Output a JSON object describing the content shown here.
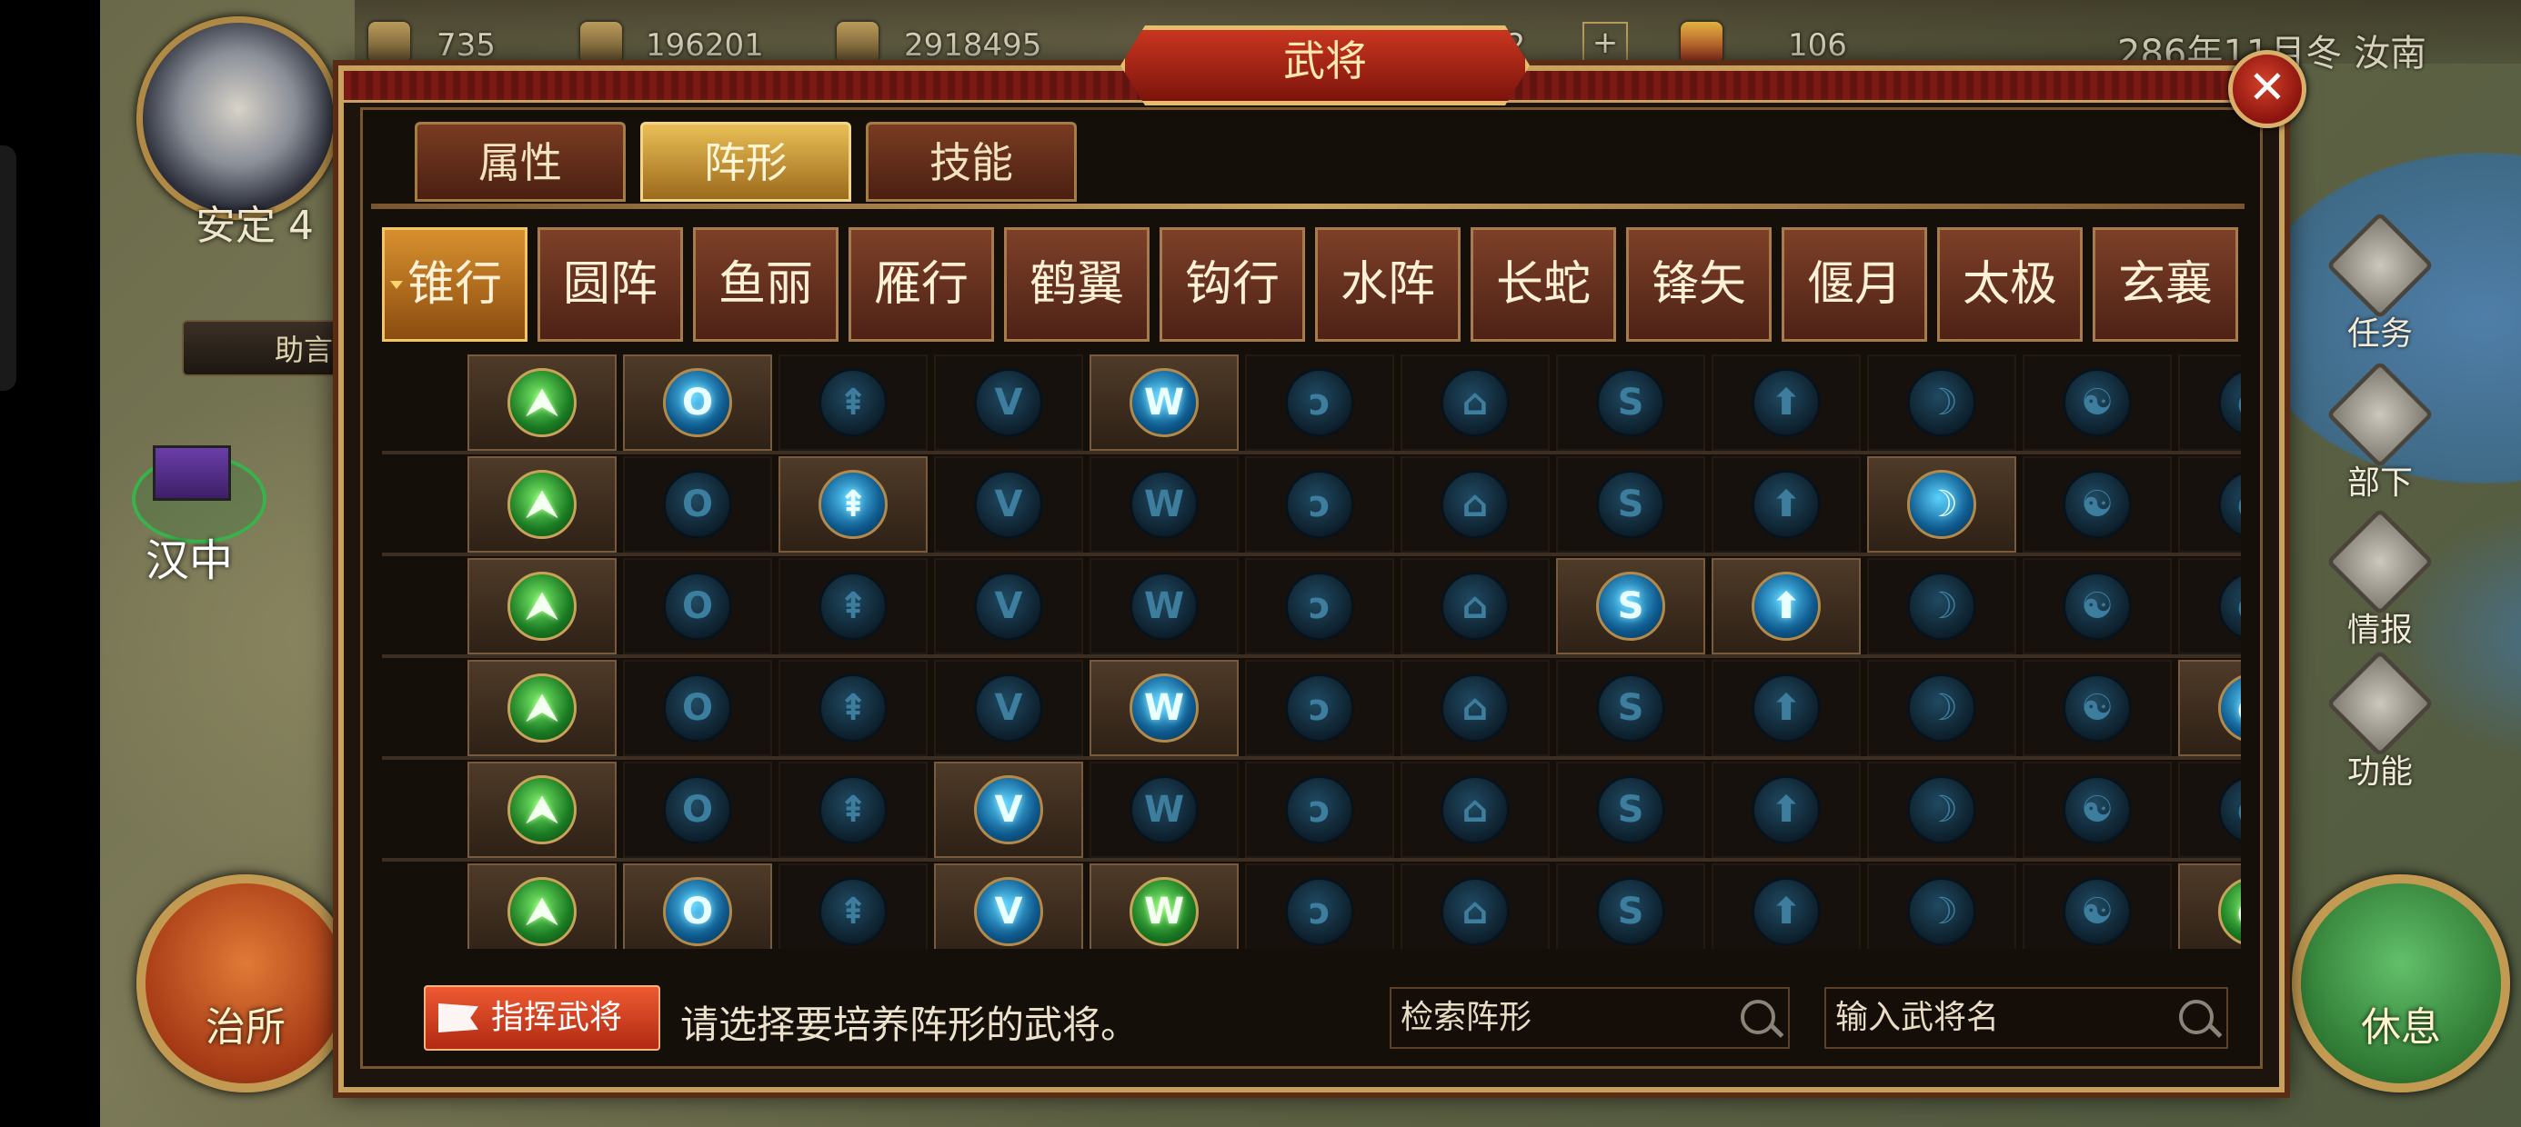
{
  "hud": {
    "resource_1": "735",
    "resource_2": "196201",
    "resource_3": "2918495",
    "resource_4": "22",
    "resource_5": "106",
    "plus_symbol": "+",
    "date_location": "286年11月冬 汝南"
  },
  "player": {
    "name": "安定 4"
  },
  "assist_button": "助言",
  "city": {
    "name": "汉中"
  },
  "side_menu": [
    {
      "label": "任务",
      "icon": "quest-scroll-icon"
    },
    {
      "label": "部下",
      "icon": "subordinate-helmet-icon"
    },
    {
      "label": "情报",
      "icon": "intel-scroll-icon"
    },
    {
      "label": "功能",
      "icon": "function-gear-icon"
    }
  ],
  "gov_button": "治所",
  "rest_button": "休息",
  "modal": {
    "title": "武将",
    "close_symbol": "✕",
    "tabs": [
      {
        "label": "属性",
        "active": false
      },
      {
        "label": "阵形",
        "active": true
      },
      {
        "label": "技能",
        "active": false
      }
    ],
    "formations": [
      {
        "label": "锥行",
        "symbol": "⮝",
        "active": true
      },
      {
        "label": "圆阵",
        "symbol": "O"
      },
      {
        "label": "鱼丽",
        "symbol": "⇞"
      },
      {
        "label": "雁行",
        "symbol": "V"
      },
      {
        "label": "鹤翼",
        "symbol": "W"
      },
      {
        "label": "钩行",
        "symbol": "ↄ"
      },
      {
        "label": "水阵",
        "symbol": "⌂"
      },
      {
        "label": "长蛇",
        "symbol": "S"
      },
      {
        "label": "锋矢",
        "symbol": "⬆"
      },
      {
        "label": "偃月",
        "symbol": "☽"
      },
      {
        "label": "太极",
        "symbol": "☯"
      },
      {
        "label": "玄襄",
        "symbol": "◐"
      }
    ],
    "grid_rows": [
      [
        "green",
        "blue",
        "dim",
        "dim",
        "blue",
        "dim",
        "dim",
        "dim",
        "dim",
        "dim",
        "dim",
        "dim"
      ],
      [
        "green",
        "dim",
        "blue",
        "dim",
        "dim",
        "dim",
        "dim",
        "dim",
        "dim",
        "blue",
        "dim",
        "dim"
      ],
      [
        "green",
        "dim",
        "dim",
        "dim",
        "dim",
        "dim",
        "dim",
        "blue",
        "blue",
        "dim",
        "dim",
        "dim"
      ],
      [
        "green",
        "dim",
        "dim",
        "dim",
        "blue",
        "dim",
        "dim",
        "dim",
        "dim",
        "dim",
        "dim",
        "blue"
      ],
      [
        "green",
        "dim",
        "dim",
        "blue",
        "dim",
        "dim",
        "dim",
        "dim",
        "dim",
        "dim",
        "dim",
        "dim"
      ],
      [
        "green",
        "blue",
        "dim",
        "blue",
        "green",
        "dim",
        "dim",
        "dim",
        "dim",
        "dim",
        "dim",
        "green"
      ]
    ],
    "command_button": "指挥武将",
    "hint": "请选择要培养阵形的武将。",
    "search_formation_placeholder": "检索阵形",
    "search_general_placeholder": "输入武将名"
  }
}
